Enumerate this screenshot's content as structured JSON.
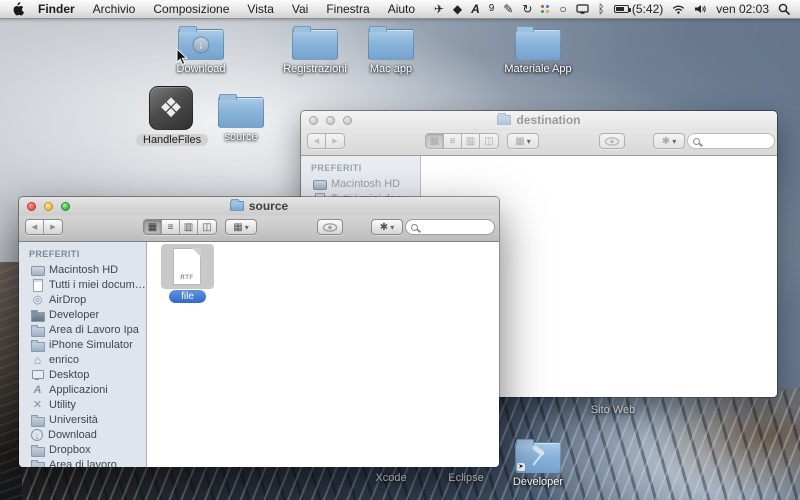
{
  "menu_bar": {
    "items": [
      "Finder",
      "Archivio",
      "Composizione",
      "Vista",
      "Vai",
      "Finestra",
      "Aiuto"
    ],
    "status": {
      "input_badge": "9",
      "battery_time": "(5:42)",
      "clock": "ven 02:03"
    }
  },
  "toolbar": {
    "back": "Indietro",
    "view": "Vista",
    "arrange": "Disposizione",
    "quicklook": "Visualizzazione rapida",
    "action": "Azione",
    "search": "Cerca"
  },
  "windows": {
    "destination": {
      "title": "destination",
      "sidebar_heading": "PREFERITI",
      "sidebar_items": [
        {
          "label": "Macintosh HD"
        },
        {
          "label": "Tutti i miei documenti"
        }
      ]
    },
    "source": {
      "title": "source",
      "sidebar_heading": "PREFERITI",
      "sidebar_items": [
        {
          "label": "Macintosh HD"
        },
        {
          "label": "Tutti i miei documenti"
        },
        {
          "label": "AirDrop"
        },
        {
          "label": "Developer"
        },
        {
          "label": "Area di Lavoro Ipa"
        },
        {
          "label": "iPhone Simulator"
        },
        {
          "label": "enrico"
        },
        {
          "label": "Desktop"
        },
        {
          "label": "Applicazioni"
        },
        {
          "label": "Utility"
        },
        {
          "label": "Università"
        },
        {
          "label": "Download"
        },
        {
          "label": "Dropbox"
        },
        {
          "label": "Area di lavoro"
        }
      ],
      "file": {
        "type": "RTF",
        "label": "file"
      }
    }
  },
  "desktop": {
    "icons": [
      {
        "label": "Download"
      },
      {
        "label": "Registrazioni"
      },
      {
        "label": "Mac app"
      },
      {
        "label": "Materiale App"
      },
      {
        "label": "HandleFiles"
      },
      {
        "label": "source"
      }
    ],
    "bottom": {
      "sito_web": "Sito Web",
      "xcode": "Xcode",
      "eclipse": "Eclipse",
      "developer": "Developer"
    }
  }
}
